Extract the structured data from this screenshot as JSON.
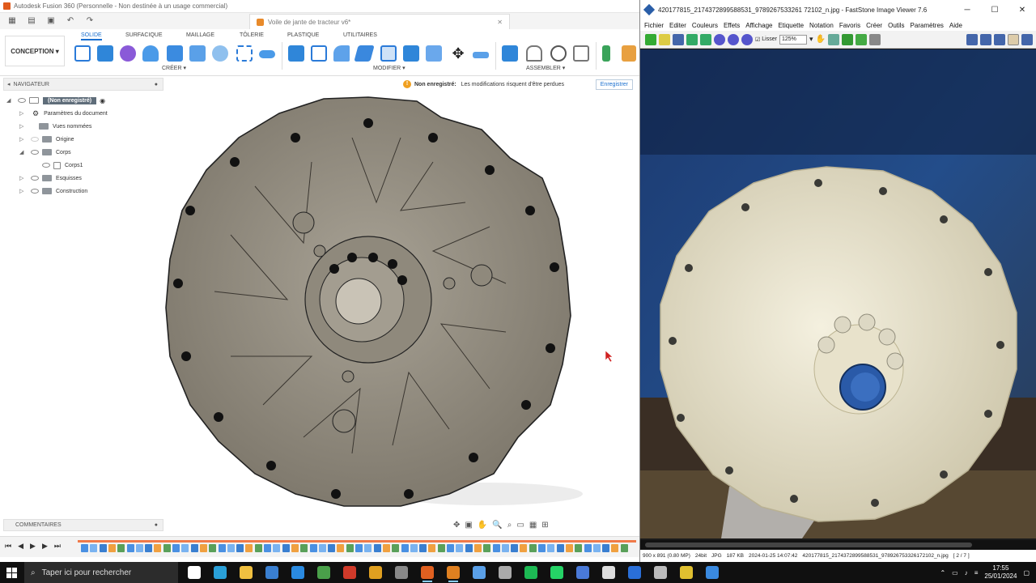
{
  "fusion": {
    "title": "Autodesk Fusion 360 (Personnelle - Non destinée à un usage commercial)",
    "document_tab": "Voile de jante de tracteur v6*",
    "workspace": "CONCEPTION",
    "ribbon_tabs": [
      "SOLIDE",
      "SURFACIQUE",
      "MAILLAGE",
      "TÔLERIE",
      "PLASTIQUE",
      "UTILITAIRES"
    ],
    "groups": {
      "create": "CRÉER",
      "modify": "MODIFIER",
      "assemble": "ASSEMBLER"
    },
    "warning": {
      "title": "Non enregistré:",
      "message": "Les modifications risquent d'être perdues",
      "save": "Enregistrer"
    },
    "navigator": {
      "title": "NAVIGATEUR",
      "root": "(Non enregistré)",
      "items": [
        {
          "label": "Paramètres du document"
        },
        {
          "label": "Vues nommées"
        },
        {
          "label": "Origine"
        },
        {
          "label": "Corps"
        },
        {
          "label": "Corps1"
        },
        {
          "label": "Esquisses"
        },
        {
          "label": "Construction"
        }
      ]
    },
    "comments": "COMMENTAIRES"
  },
  "viewer": {
    "title": "420177815_2174372899588531_9789267533261 72102_n.jpg - FastStone Image Viewer 7.6",
    "menu": [
      "Fichier",
      "Editer",
      "Couleurs",
      "Effets",
      "Affichage",
      "Etiquette",
      "Notation",
      "Favoris",
      "Créer",
      "Outils",
      "Paramètres",
      "Aide"
    ],
    "smooth_label": "Lisser",
    "zoom": "125%",
    "status": {
      "dims": "900 x 891 (0.80 MP)",
      "depth": "24bit",
      "format": "JPG",
      "size": "187 KB",
      "date": "2024-01-25 14:07:42",
      "file": "420177815_2174372899588531_978926753326172102_n.jpg",
      "index": "[ 2 / 7 ]"
    }
  },
  "taskbar": {
    "search_placeholder": "Taper ici pour rechercher",
    "time": "17:55",
    "date": "25/01/2024"
  }
}
